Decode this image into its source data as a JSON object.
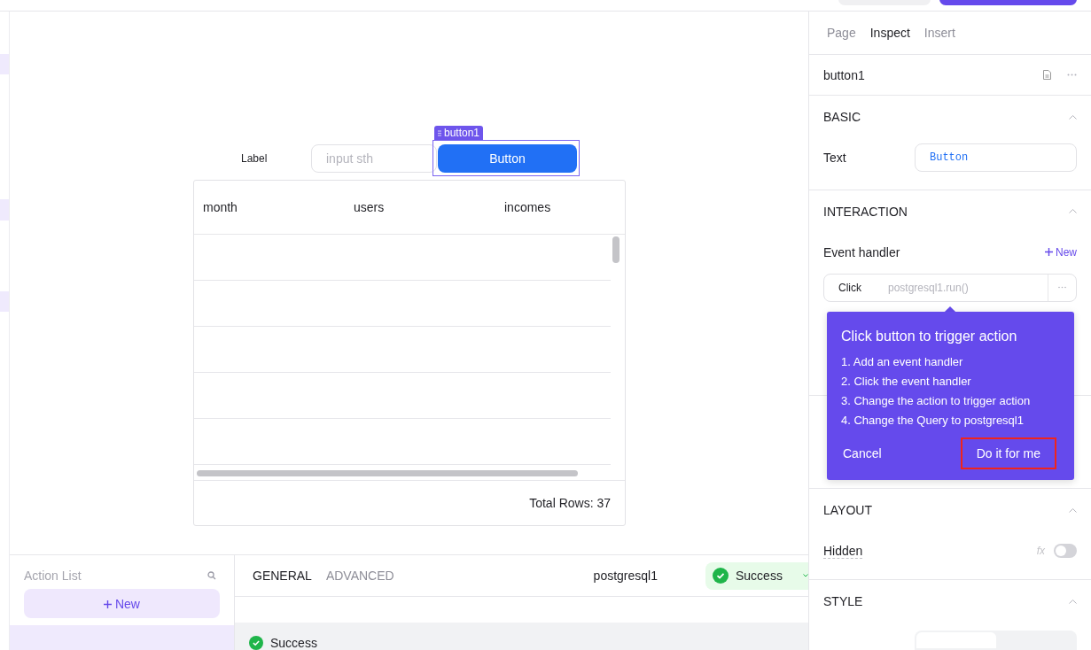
{
  "canvas": {
    "label": "Label",
    "input": {
      "placeholder": "input sth"
    },
    "button": {
      "text": "Button",
      "tag": "button1",
      "selected": true
    },
    "table": {
      "columns": [
        "month",
        "users",
        "incomes"
      ],
      "footer": "Total Rows: 37"
    }
  },
  "inspector": {
    "tabs": [
      {
        "label": "Page",
        "selected": false
      },
      {
        "label": "Inspect",
        "selected": true
      },
      {
        "label": "Insert",
        "selected": false
      }
    ],
    "component": "button1",
    "basic": {
      "title": "BASIC",
      "text_label": "Text",
      "text_value": "Button"
    },
    "interaction": {
      "title": "INTERACTION",
      "event_label": "Event handler",
      "new_label": "New",
      "event": "Click",
      "action": "postgresql1.run()"
    },
    "layout": {
      "title": "LAYOUT",
      "hidden_label": "Hidden",
      "fx": "fx",
      "hidden_on": false
    },
    "style": {
      "title": "STYLE"
    }
  },
  "popover": {
    "title": "Click button to trigger action",
    "steps": [
      "1. Add an event handler",
      "2. Click the event handler",
      "3. Change the action to trigger action",
      "4. Change the Query to postgresql1"
    ],
    "cancel": "Cancel",
    "confirm": "Do it for me",
    "confirm_highlighted": true
  },
  "bottom": {
    "action_list": {
      "title": "Action List",
      "new_label": "New"
    },
    "tabs": [
      {
        "label": "GENERAL",
        "selected": true
      },
      {
        "label": "ADVANCED",
        "selected": false
      }
    ],
    "query": "postgresql1",
    "status": "Success",
    "result": "Success"
  }
}
